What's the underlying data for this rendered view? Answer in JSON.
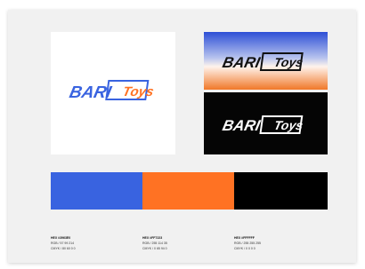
{
  "brand": {
    "name_part1": "BARI",
    "name_part2": "Toys"
  },
  "colors": {
    "blue": "#3963E0",
    "orange": "#FF7223",
    "black": "#000000"
  },
  "palette": [
    {
      "hex": "HEX #3963E0",
      "rgb": "RGB / 57 99 214",
      "cmyk": "CMYK / 80 60 0 0",
      "swatch": "#3963E0"
    },
    {
      "hex": "HEX #FF7223",
      "rgb": "RGB / 255 114 35",
      "cmyk": "CMYK / 0 65 94 0",
      "swatch": "#FF7223"
    },
    {
      "hex": "HEX #FFFFFF",
      "rgb": "RGB / 255 255 255",
      "cmyk": "CMYK / 0 0 0 0",
      "swatch": "#000000"
    }
  ]
}
